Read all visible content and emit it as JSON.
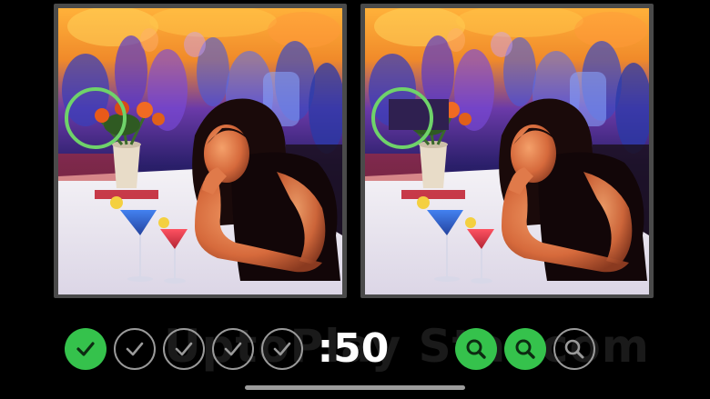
{
  "game": {
    "timer": ":50",
    "watermark": "UptoPlay Star.com"
  },
  "scene": {
    "description_icon": "bar-scene-woman-cocktails-image",
    "found_marker_color": "#6fd36a"
  },
  "hud": {
    "found": [
      {
        "state": "found",
        "icon": "check-icon"
      },
      {
        "state": "pending",
        "icon": "check-icon"
      },
      {
        "state": "pending",
        "icon": "check-icon"
      },
      {
        "state": "pending",
        "icon": "check-icon"
      },
      {
        "state": "pending",
        "icon": "check-icon"
      }
    ],
    "hints": [
      {
        "state": "available",
        "icon": "magnifier-icon"
      },
      {
        "state": "available",
        "icon": "magnifier-icon"
      },
      {
        "state": "used",
        "icon": "magnifier-icon"
      }
    ]
  },
  "colors": {
    "accent_green": "#35c24c",
    "pending_gray": "#9a9a9a",
    "panel_frame": "#4a4a4a"
  }
}
